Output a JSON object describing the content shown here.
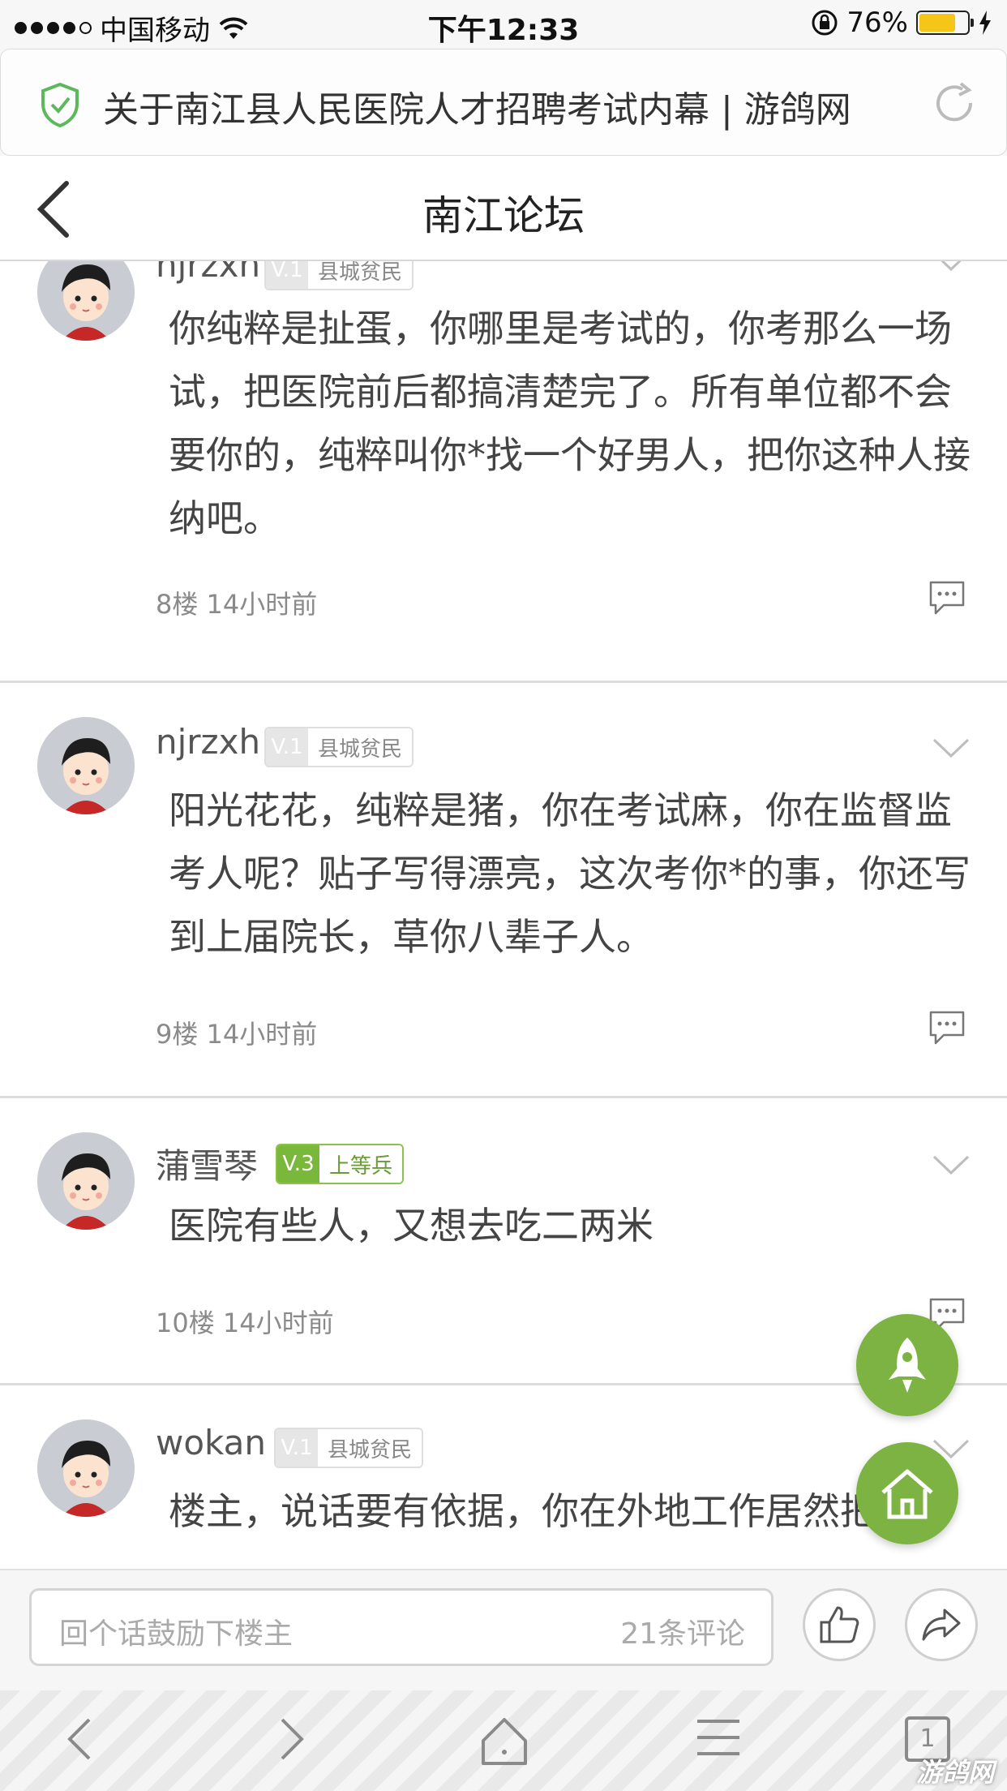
{
  "status_bar": {
    "carrier": "中国移动",
    "time": "下午12:33",
    "battery_percent": "76%"
  },
  "address_bar": {
    "url_title": "关于南江县人民医院人才招聘考试内幕 | 游鸽网"
  },
  "header": {
    "title": "南江论坛"
  },
  "comments": [
    {
      "username": "njrzxh",
      "level": "V.1",
      "rank": "县城贫民",
      "body": "你纯粹是扯蛋，你哪里是考试的，你考那么一场试，把医院前后都搞清楚完了。所有单位都不会要你的，纯粹叫你*找一个好男人，把你这种人接纳吧。",
      "floor": "8楼",
      "time": "14小时前"
    },
    {
      "username": "njrzxh",
      "level": "V.1",
      "rank": "县城贫民",
      "body": "阳光花花，纯粹是猪，你在考试麻，你在监督监考人呢？贴子写得漂亮，这次考你*的事，你还写到上届院长，草你八辈子人。",
      "floor": "9楼",
      "time": "14小时前"
    },
    {
      "username": "蒲雪琴",
      "level": "V.3",
      "rank": "上等兵",
      "body": "医院有些人，又想去吃二两米",
      "floor": "10楼",
      "time": "14小时前"
    },
    {
      "username": "wokan",
      "level": "V.1",
      "rank": "县城贫民",
      "body": "楼主，说话要有依据，你在外地工作居然把医",
      "floor": "",
      "time": ""
    }
  ],
  "comment_bar": {
    "placeholder": "回个话鼓励下楼主",
    "count": "21条评论"
  },
  "browser_toolbar": {
    "tab_count": "1"
  },
  "watermark": "游鸽网",
  "colors": {
    "accent_green": "#7cb342",
    "badge_green": "#79b83a",
    "battery_yellow": "#f5c518"
  }
}
